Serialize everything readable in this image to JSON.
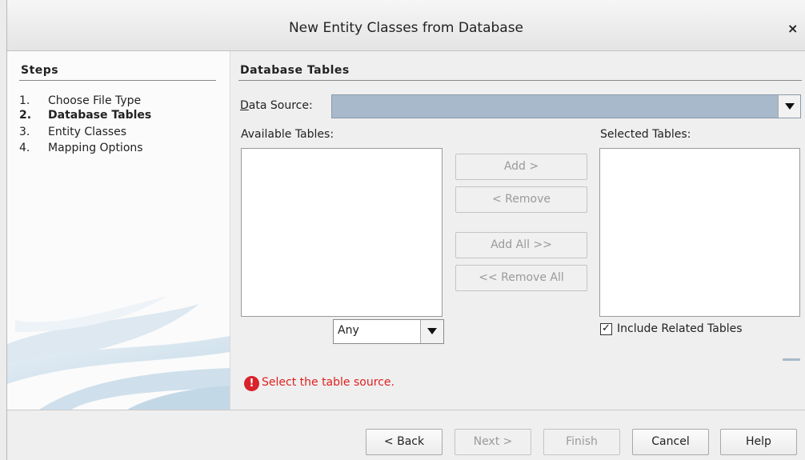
{
  "window": {
    "title": "New Entity Classes from Database",
    "close_glyph": "×"
  },
  "steps": {
    "heading": "Steps",
    "items": [
      {
        "num": "1.",
        "label": "Choose File Type",
        "current": false
      },
      {
        "num": "2.",
        "label": "Database Tables",
        "current": true
      },
      {
        "num": "3.",
        "label": "Entity Classes",
        "current": false
      },
      {
        "num": "4.",
        "label": "Mapping Options",
        "current": false
      }
    ]
  },
  "main": {
    "heading": "Database Tables",
    "data_source": {
      "label": "Data Source:",
      "mnemonic": "D",
      "value": ""
    },
    "available": {
      "label": "Available Tables:",
      "filter_value": "Any"
    },
    "selected": {
      "label": "Selected Tables:"
    },
    "buttons": {
      "add": "Add >",
      "remove": "< Remove",
      "add_all": "Add All >>",
      "remove_all": "<< Remove All"
    },
    "include_related": {
      "label": "Include Related Tables",
      "checked": true
    },
    "error": {
      "icon": "error-icon",
      "text": "Select the table source."
    }
  },
  "footer": {
    "back": "< Back",
    "next": "Next >",
    "finish": "Finish",
    "cancel": "Cancel",
    "help": "Help"
  },
  "colors": {
    "accent": "#a7b9ca",
    "error": "#e02020"
  }
}
